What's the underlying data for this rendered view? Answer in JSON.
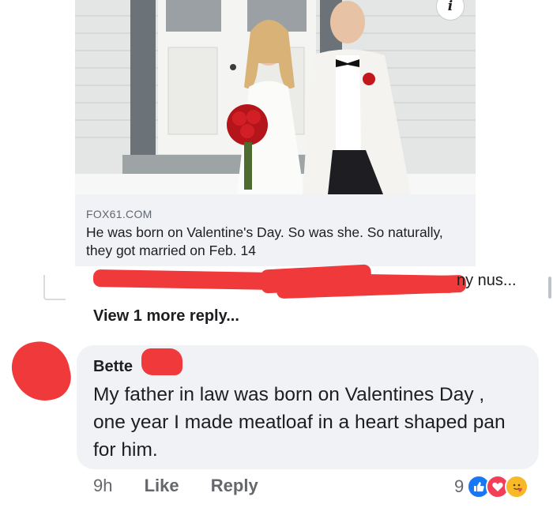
{
  "link_card": {
    "source": "FOX61.COM",
    "title": "He was born on Valentine's Day. So was she. So naturally, they got married on Feb. 14",
    "info_icon": "i"
  },
  "reply_preview": {
    "visible_tail": "ny nus...",
    "view_more": "View 1 more reply..."
  },
  "comment": {
    "author": "Bette",
    "text": "My father in law was born on Valentines Day , one year I made meatloaf in a heart shaped pan for him.",
    "time": "9h",
    "like_label": "Like",
    "reply_label": "Reply",
    "reaction_count": "9",
    "reactions": [
      "like-icon",
      "love-icon",
      "care-icon"
    ]
  },
  "colors": {
    "redaction": "#f0393a",
    "bubble": "#f0f2f5",
    "like_blue": "#1877f2",
    "love_red": "#f33e58",
    "care_yellow": "#f7b928"
  }
}
